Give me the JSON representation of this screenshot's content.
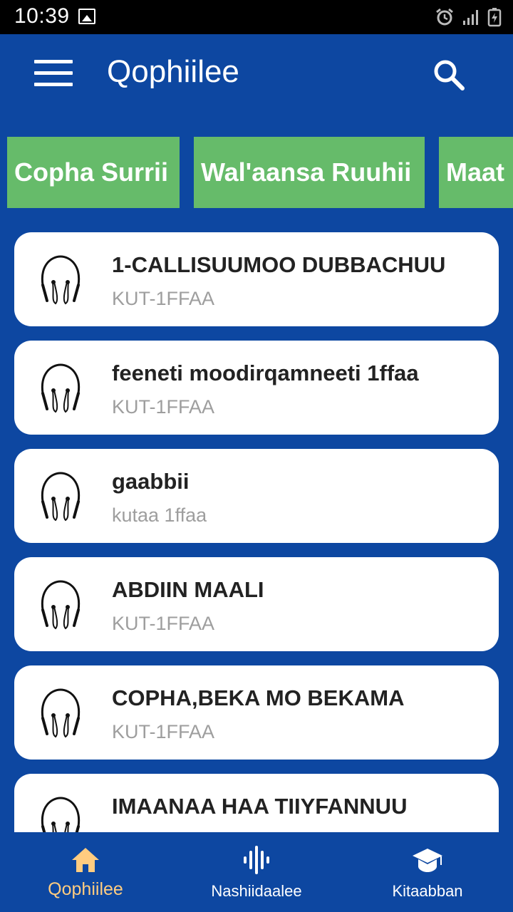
{
  "status_bar": {
    "time": "10:39"
  },
  "app_bar": {
    "title": "Qophiilee"
  },
  "categories": [
    {
      "label": "Copha Surrii"
    },
    {
      "label": "Wal'aansa Ruuhii"
    },
    {
      "label": "Maat"
    }
  ],
  "items": [
    {
      "title": "1-CALLISUUMOO DUBBACHUU",
      "subtitle": "KUT-1FFAA"
    },
    {
      "title": "feeneti moodirqamneeti 1ffaa",
      "subtitle": "KUT-1FFAA"
    },
    {
      "title": "gaabbii",
      "subtitle": "kutaa 1ffaa"
    },
    {
      "title": "ABDIIN MAALI",
      "subtitle": "KUT-1FFAA"
    },
    {
      "title": "COPHA,BEKA MO BEKAMA",
      "subtitle": "KUT-1FFAA"
    },
    {
      "title": "IMAANAA HAA TIIYFANNUU",
      "subtitle": ""
    }
  ],
  "bottom_nav": {
    "items": [
      {
        "label": "Qophiilee",
        "icon": "home-icon",
        "active": true
      },
      {
        "label": "Nashiidaalee",
        "icon": "audio-wave-icon",
        "active": false
      },
      {
        "label": "Kitaabban",
        "icon": "graduation-cap-icon",
        "active": false
      }
    ]
  },
  "colors": {
    "primary": "#0d47a1",
    "chip": "#66bb6a",
    "active_nav": "#ffcc80"
  }
}
